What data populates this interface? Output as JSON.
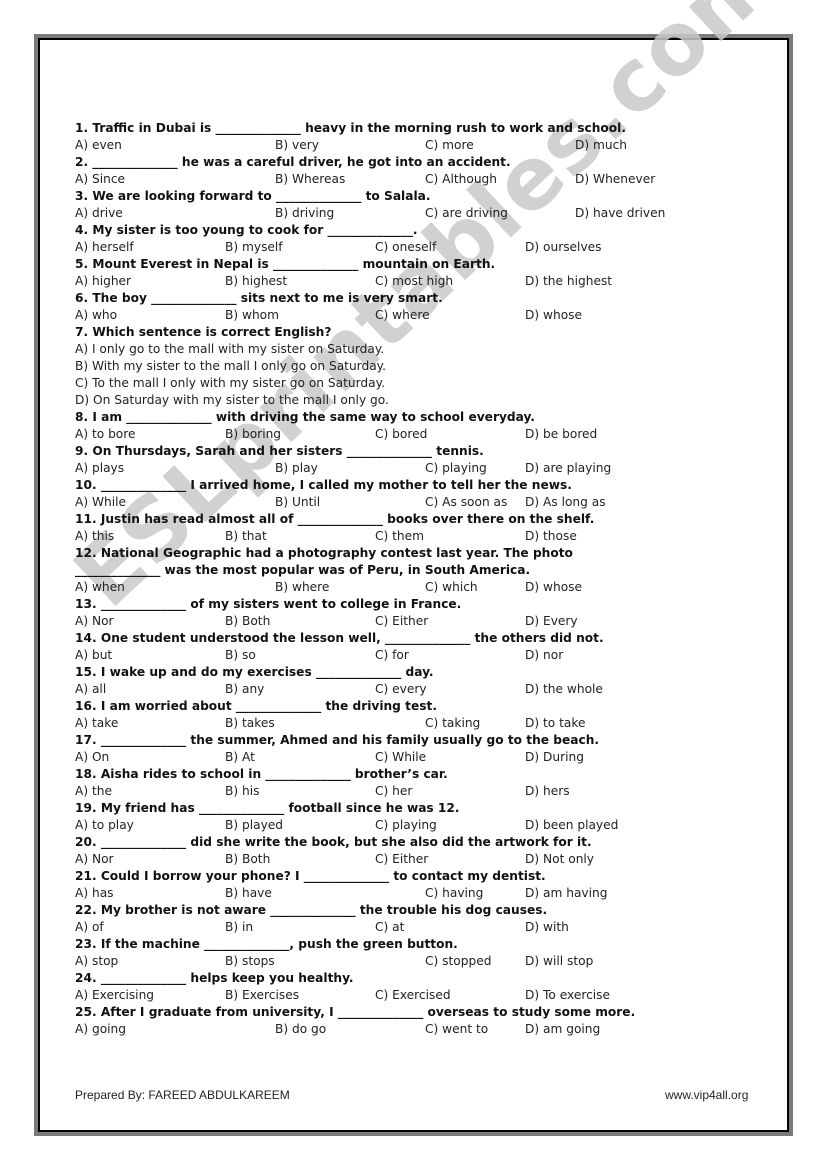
{
  "watermark": "ESLprintables.com",
  "questions": [
    {
      "text": "1. Traffic in Dubai is ______________ heavy in the morning rush to work and school.",
      "options": [
        "A) even",
        "B) very",
        "C) more",
        "D) much"
      ]
    },
    {
      "text": "2. ______________ he was a careful driver, he got into an accident.",
      "options": [
        "A) Since",
        "B) Whereas",
        "C) Although",
        "D) Whenever"
      ]
    },
    {
      "text": "3. We are looking forward to ______________ to Salala.",
      "options": [
        "A) drive",
        "B) driving",
        "C) are driving",
        "D) have driven"
      ]
    },
    {
      "text": "4. My sister is too young to cook for ______________.",
      "options": [
        "A) herself",
        "B) myself",
        "C) oneself",
        "D) ourselves"
      ]
    },
    {
      "text": "5. Mount Everest in Nepal is ______________ mountain on Earth.",
      "options": [
        "A) higher",
        "B) highest",
        "C) most high",
        "D) the highest"
      ]
    },
    {
      "text": "6. The boy ______________ sits next to me is very smart.",
      "options": [
        "A) who",
        "B) whom",
        "C) where",
        "D) whose"
      ]
    },
    {
      "text": "7. Which sentence is correct English?",
      "options": [
        "A) I only go to the mall with my sister on Saturday.",
        "B) With my sister to the mall I only go on Saturday.",
        "C) To the mall I only with my sister go on Saturday.",
        "D) On Saturday with my sister to the mall I only go."
      ]
    },
    {
      "text": "8. I am ______________ with driving the same way to school everyday.",
      "options": [
        "A) to bore",
        "B) boring",
        "C) bored",
        "D) be bored"
      ]
    },
    {
      "text": "9. On Thursdays, Sarah and her sisters ______________ tennis.",
      "options": [
        "A) plays",
        "B) play",
        "C) playing",
        "D) are playing"
      ]
    },
    {
      "text": "10. ______________ I arrived home, I called my mother to tell her the news.",
      "options": [
        "A) While",
        "B) Until",
        "C) As soon as",
        "D) As long as"
      ]
    },
    {
      "text": "11. Justin has read almost all of ______________ books over there on the shelf.",
      "options": [
        "A) this",
        "B) that",
        "C) them",
        "D) those"
      ]
    },
    {
      "text": "12. National Geographic had a photography contest last year. The photo",
      "text2": "______________ was the most popular was of Peru, in South America.",
      "options": [
        "A) when",
        "B) where",
        "C) which",
        "D) whose"
      ]
    },
    {
      "text": "13. ______________ of my sisters went to college in France.",
      "options": [
        "A) Nor",
        "B) Both",
        "C) Either",
        "D) Every"
      ]
    },
    {
      "text": "14. One student understood the lesson well, ______________ the others did not.",
      "options": [
        "A) but",
        "B) so",
        "C) for",
        "D) nor"
      ]
    },
    {
      "text": "15. I wake up and do my exercises ______________ day.",
      "options": [
        "A) all",
        "B) any",
        "C) every",
        "D) the whole"
      ]
    },
    {
      "text": "16. I am worried about ______________ the driving test.",
      "options": [
        "A) take",
        "B) takes",
        "C) taking",
        "D) to take"
      ]
    },
    {
      "text": "17. ______________ the summer, Ahmed and his family usually go to the beach.",
      "options": [
        "A) On",
        "B) At",
        "C) While",
        "D) During"
      ]
    },
    {
      "text": "18. Aisha rides to school in ______________ brother’s car.",
      "options": [
        "A) the",
        "B) his",
        "C) her",
        "D) hers"
      ]
    },
    {
      "text": "19. My friend has ______________ football since he was 12.",
      "options": [
        "A) to play",
        "B) played",
        "C) playing",
        "D) been played"
      ]
    },
    {
      "text": "20. ______________ did she write the book, but she also did the artwork for it.",
      "options": [
        "A) Nor",
        "B) Both",
        "C) Either",
        "D) Not only"
      ]
    },
    {
      "text": "21. Could I borrow your phone? I ______________ to contact my dentist.",
      "options": [
        "A) has",
        "B) have",
        "C) having",
        "D) am having"
      ]
    },
    {
      "text": "22. My brother is not aware ______________ the trouble his dog causes.",
      "options": [
        "A) of",
        "B) in",
        "C) at",
        "D) with"
      ]
    },
    {
      "text": "23. If the machine ______________, push the green button.",
      "options": [
        "A) stop",
        "B) stops",
        "C) stopped",
        "D) will stop"
      ]
    },
    {
      "text": "24. ______________ helps keep you healthy.",
      "options": [
        "A) Exercising",
        "B) Exercises",
        "C) Exercised",
        "D) To exercise"
      ]
    },
    {
      "text": "25. After I graduate from university, I ______________ overseas to study some more.",
      "options": [
        "A) going",
        "B) do go",
        "C) went to",
        "D) am going"
      ]
    }
  ],
  "footer": {
    "prepared_by": "Prepared By: FAREED ABDULKAREEM",
    "website": "www.vip4all.org"
  }
}
